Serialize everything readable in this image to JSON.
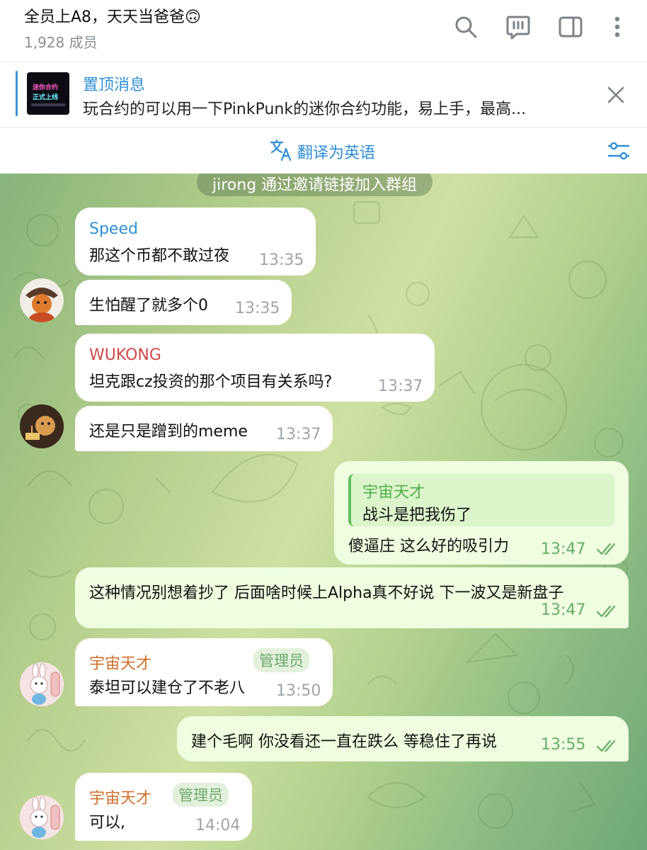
{
  "header": {
    "title": "全员上A8，天天当爸爸🙃",
    "members": "1,928 成员",
    "icons": [
      "search-icon",
      "chat-icon",
      "sidebar-icon",
      "more-icon"
    ]
  },
  "pinned": {
    "title": "置顶消息",
    "text": "玩合约的可以用一下PinkPunk的迷你合约功能，易上手，最高...",
    "thumb_line1": "迷你合约",
    "thumb_line2": "正式上线"
  },
  "translate": {
    "label": "翻译为英语"
  },
  "service_message": "jirong 通过邀请链接加入群组",
  "messages": [
    {
      "sender": "Speed",
      "sender_color": "#2f8fd6",
      "text": "那这个币都不敢过夜",
      "time": "13:35"
    },
    {
      "text": "生怕醒了就多个0",
      "time": "13:35"
    },
    {
      "sender": "WUKONG",
      "sender_color": "#d04848",
      "text": "坦克跟cz投资的那个项目有关系吗?",
      "time": "13:37"
    },
    {
      "text": "还是只是蹭到的meme",
      "time": "13:37"
    },
    {
      "reply_sender": "宇宙天才",
      "reply_text": "战斗是把我伤了",
      "text": "傻逼庄 这么好的吸引力",
      "time": "13:47",
      "outgoing": true
    },
    {
      "text": "这种情况别想着抄了 后面啥时候上Alpha真不好说 下一波又是新盘子",
      "time": "13:47",
      "outgoing": true
    },
    {
      "sender": "宇宙天才",
      "sender_color": "#cf6f2b",
      "badge": "管理员",
      "text": "泰坦可以建仓了不老八",
      "time": "13:50"
    },
    {
      "text": "建个毛啊 你没看还一直在跌么 等稳住了再说",
      "time": "13:55",
      "outgoing": true
    },
    {
      "sender": "宇宙天才",
      "sender_color": "#cf6f2b",
      "badge": "管理员",
      "text": "可以,",
      "time": "14:04"
    }
  ]
}
